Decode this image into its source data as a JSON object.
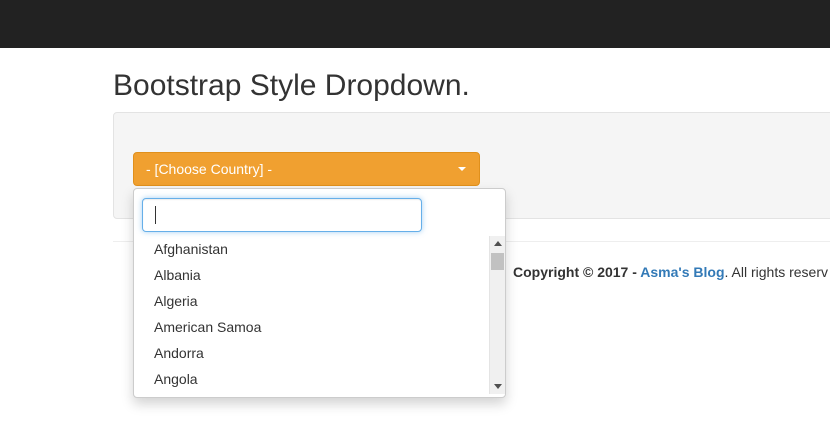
{
  "page": {
    "title": "Bootstrap Style Dropdown."
  },
  "dropdown": {
    "label": "- [Choose Country] -",
    "button_color": "#f0a030",
    "search": {
      "value": "",
      "placeholder": ""
    },
    "options": [
      "Afghanistan",
      "Albania",
      "Algeria",
      "American Samoa",
      "Andorra",
      "Angola"
    ]
  },
  "footer": {
    "copyright": "Copyright © 2017 - ",
    "link_text": "Asma's Blog",
    "suffix": ". All rights reserv",
    "link_color": "#337ab7"
  },
  "icons": {
    "caret": "caret-down-icon",
    "scroll_up": "scroll-up-arrow-icon",
    "scroll_down": "scroll-down-arrow-icon"
  }
}
